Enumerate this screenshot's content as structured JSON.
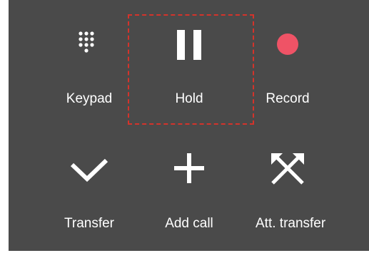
{
  "call_controls": {
    "buttons": [
      {
        "id": "keypad",
        "label": "Keypad",
        "icon": "keypad-icon"
      },
      {
        "id": "hold",
        "label": "Hold",
        "icon": "pause-icon"
      },
      {
        "id": "record",
        "label": "Record",
        "icon": "record-icon"
      },
      {
        "id": "transfer",
        "label": "Transfer",
        "icon": "transfer-icon"
      },
      {
        "id": "add-call",
        "label": "Add call",
        "icon": "plus-icon"
      },
      {
        "id": "att-transfer",
        "label": "Att. transfer",
        "icon": "attended-transfer-icon"
      }
    ],
    "highlighted_button": "hold"
  },
  "colors": {
    "panel_background": "#4a4a4a",
    "icon_color": "#ffffff",
    "record_color": "#ef5366",
    "highlight_border": "#d4332b"
  }
}
